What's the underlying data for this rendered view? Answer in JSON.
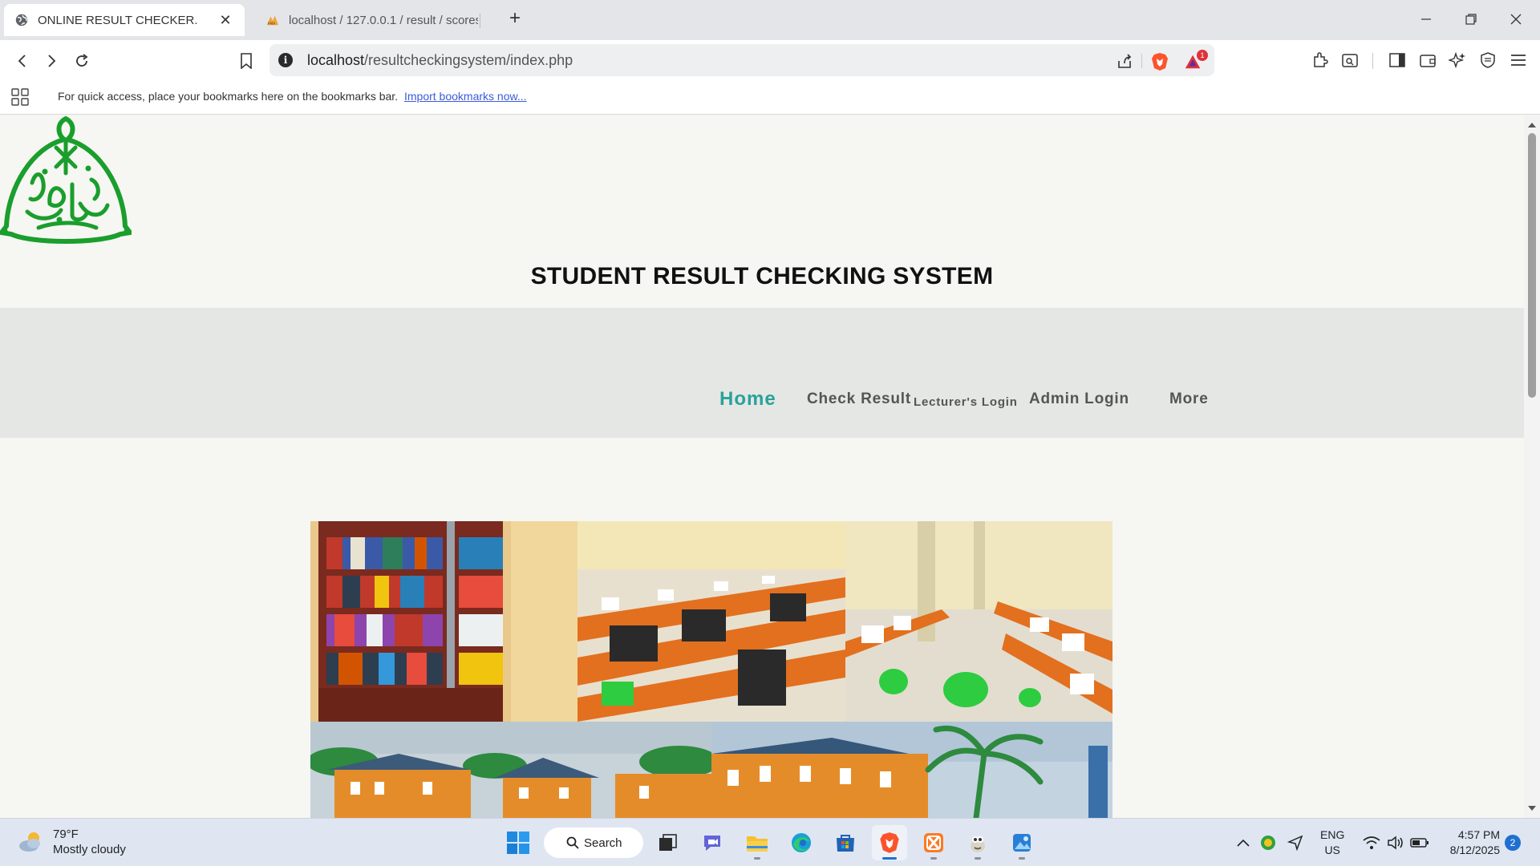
{
  "browser": {
    "tabs": [
      {
        "title": "ONLINE RESULT CHECKER.",
        "active": true
      },
      {
        "title": "localhost / 127.0.0.1 / result / scores",
        "active": false
      }
    ],
    "url": {
      "host": "localhost",
      "path": "/resultcheckingsystem/index.php"
    },
    "shields_badge": "1",
    "bookmarks_message": "For quick access, place your bookmarks here on the bookmarks bar.",
    "bookmarks_link": "Import bookmarks now..."
  },
  "page": {
    "site_title": "STUDENT RESULT CHECKING SYSTEM",
    "nav": {
      "home": "Home",
      "check_result": "Check Result",
      "lecturers_login": "Lecturer's Login",
      "admin_login": "Admin Login",
      "more": "More"
    },
    "colors": {
      "nav_active": "#2aa19b",
      "nav_default": "#555555",
      "logo_green": "#1a9e2c",
      "nav_band": "#e4e7e3"
    },
    "gallery": [
      "library-bookshelf-photo",
      "computer-lab-photo",
      "exam-hall-photo",
      "campus-building-photo",
      "campus-building-palm-photo"
    ]
  },
  "taskbar": {
    "weather_temp": "79°F",
    "weather_desc": "Mostly cloudy",
    "search_label": "Search",
    "language": "ENG",
    "region": "US",
    "time": "4:57 PM",
    "date": "8/12/2025",
    "notification_count": "2"
  }
}
